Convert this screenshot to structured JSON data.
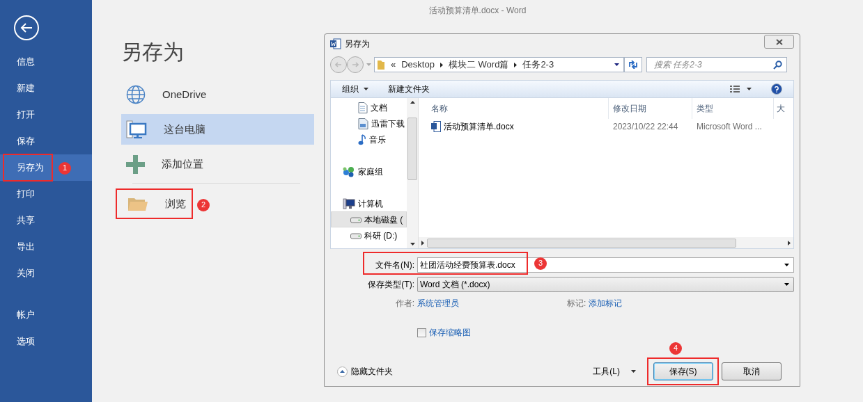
{
  "title_bar": {
    "title": "活动预算清单.docx - Word"
  },
  "backstage_nav": {
    "items": [
      {
        "label": "信息",
        "selected": false
      },
      {
        "label": "新建",
        "selected": false
      },
      {
        "label": "打开",
        "selected": false
      },
      {
        "label": "保存",
        "selected": false
      },
      {
        "label": "另存为",
        "selected": true,
        "callout": "1"
      },
      {
        "label": "打印",
        "selected": false
      },
      {
        "label": "共享",
        "selected": false
      },
      {
        "label": "导出",
        "selected": false
      },
      {
        "label": "关闭",
        "selected": false
      }
    ],
    "bottom_items": [
      {
        "label": "帐户",
        "selected": false
      },
      {
        "label": "选项",
        "selected": false
      }
    ]
  },
  "page_heading": "另存为",
  "places": [
    {
      "label": "OneDrive",
      "kind": "globe",
      "selected": false
    },
    {
      "label": "这台电脑",
      "kind": "computer",
      "selected": true
    },
    {
      "label": "添加位置",
      "kind": "plus",
      "selected": false
    },
    {
      "label": "浏览",
      "kind": "folder",
      "selected": false,
      "separator_before": true,
      "callout": "2"
    }
  ],
  "dialog": {
    "title": "另存为",
    "breadcrumb_prefix": "«",
    "breadcrumb": [
      "Desktop",
      "模块二 Word篇",
      "任务2-3"
    ],
    "search": {
      "placeholder": "搜索 任务2-3"
    },
    "toolbar": {
      "organize": "组织",
      "new_folder": "新建文件夹"
    },
    "nav_pane": [
      {
        "children": [
          {
            "label": "文档",
            "kind": "document",
            "selected": false
          },
          {
            "label": "迅雷下载",
            "kind": "download",
            "selected": false
          },
          {
            "label": "音乐",
            "kind": "music",
            "selected": false
          }
        ]
      },
      {
        "label": "家庭组",
        "kind": "homegroup",
        "selected": false
      },
      {
        "label": "计算机",
        "kind": "computer",
        "selected": false,
        "children": [
          {
            "label": "本地磁盘 (",
            "kind": "drive",
            "selected": true
          },
          {
            "label": "科研 (D:)",
            "kind": "drive",
            "selected": false
          }
        ]
      }
    ],
    "columns": [
      "名称",
      "修改日期",
      "类型",
      "大"
    ],
    "files": [
      {
        "name": "活动预算清单.docx",
        "modified": "2023/10/22 22:44",
        "type": "Microsoft Word ..."
      }
    ],
    "filename": {
      "label": "文件名(N):",
      "value": "社团活动经费预算表.docx",
      "callout": "3"
    },
    "save_type": {
      "label": "保存类型(T):",
      "value": "Word 文档 (*.docx)"
    },
    "author": {
      "label": "作者:",
      "value": "系统管理员"
    },
    "tags": {
      "label": "标记:",
      "value": "添加标记"
    },
    "thumbnail": {
      "label": "保存缩略图",
      "checked": false
    },
    "hide_folders": "隐藏文件夹",
    "tools": "工具(L)",
    "buttons": [
      {
        "label": "保存(S)",
        "kind": "primary",
        "callout": "4"
      },
      {
        "label": "取消",
        "kind": "normal"
      }
    ]
  }
}
